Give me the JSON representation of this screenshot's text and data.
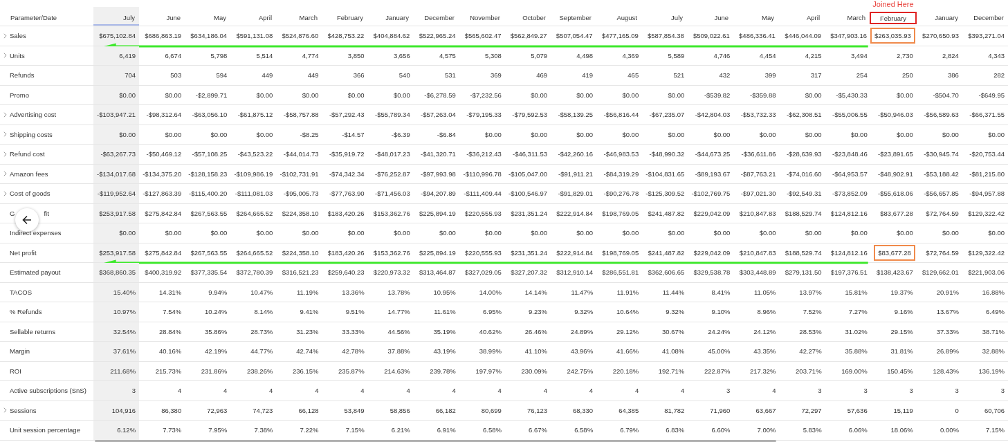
{
  "annotation": {
    "label": "Joined Here"
  },
  "table": {
    "corner": "Parameter/Date",
    "columns": [
      {
        "label": "July",
        "selected": true,
        "highlighted": false
      },
      {
        "label": "June",
        "selected": false,
        "highlighted": false
      },
      {
        "label": "May",
        "selected": false,
        "highlighted": false
      },
      {
        "label": "April",
        "selected": false,
        "highlighted": false
      },
      {
        "label": "March",
        "selected": false,
        "highlighted": false
      },
      {
        "label": "February",
        "selected": false,
        "highlighted": false
      },
      {
        "label": "January",
        "selected": false,
        "highlighted": false
      },
      {
        "label": "December",
        "selected": false,
        "highlighted": false
      },
      {
        "label": "November",
        "selected": false,
        "highlighted": false
      },
      {
        "label": "October",
        "selected": false,
        "highlighted": false
      },
      {
        "label": "September",
        "selected": false,
        "highlighted": false
      },
      {
        "label": "August",
        "selected": false,
        "highlighted": false
      },
      {
        "label": "July",
        "selected": false,
        "highlighted": false
      },
      {
        "label": "June",
        "selected": false,
        "highlighted": false
      },
      {
        "label": "May",
        "selected": false,
        "highlighted": false
      },
      {
        "label": "April",
        "selected": false,
        "highlighted": false
      },
      {
        "label": "March",
        "selected": false,
        "highlighted": false
      },
      {
        "label": "February",
        "selected": false,
        "highlighted": true
      },
      {
        "label": "January",
        "selected": false,
        "highlighted": false
      },
      {
        "label": "December",
        "selected": false,
        "highlighted": false
      }
    ],
    "rows": [
      {
        "label": "Sales",
        "expandable": true,
        "highlighted": true,
        "values": [
          "$675,102.84",
          "$686,863.19",
          "$634,186.04",
          "$591,131.08",
          "$524,876.60",
          "$428,753.22",
          "$404,884.62",
          "$522,965.24",
          "$565,602.47",
          "$562,849.27",
          "$507,054.47",
          "$477,165.09",
          "$587,854.38",
          "$509,022.61",
          "$486,336.41",
          "$446,044.09",
          "$347,903.16",
          "$263,035.93",
          "$270,650.93",
          "$393,271.04"
        ]
      },
      {
        "label": "Units",
        "expandable": true,
        "highlighted": false,
        "values": [
          "6,419",
          "6,674",
          "5,798",
          "5,514",
          "4,774",
          "3,850",
          "3,656",
          "4,575",
          "5,308",
          "5,079",
          "4,498",
          "4,369",
          "5,589",
          "4,746",
          "4,454",
          "4,215",
          "3,494",
          "2,730",
          "2,824",
          "4,343"
        ]
      },
      {
        "label": "Refunds",
        "expandable": false,
        "highlighted": false,
        "values": [
          "704",
          "503",
          "594",
          "449",
          "449",
          "366",
          "540",
          "531",
          "369",
          "469",
          "419",
          "465",
          "521",
          "432",
          "399",
          "317",
          "254",
          "250",
          "386",
          "282"
        ]
      },
      {
        "label": "Promo",
        "expandable": false,
        "highlighted": false,
        "values": [
          "$0.00",
          "$0.00",
          "-$2,899.71",
          "$0.00",
          "$0.00",
          "$0.00",
          "$0.00",
          "-$6,278.59",
          "-$7,232.56",
          "$0.00",
          "$0.00",
          "$0.00",
          "$0.00",
          "-$539.82",
          "-$359.88",
          "$0.00",
          "-$5,430.33",
          "$0.00",
          "-$504.70",
          "-$649.95"
        ]
      },
      {
        "label": "Advertising cost",
        "expandable": true,
        "highlighted": false,
        "values": [
          "-$103,947.21",
          "-$98,312.64",
          "-$63,056.10",
          "-$61,875.12",
          "-$58,757.88",
          "-$57,292.43",
          "-$55,789.34",
          "-$57,263.04",
          "-$79,195.33",
          "-$79,592.53",
          "-$58,139.25",
          "-$56,816.44",
          "-$67,235.07",
          "-$42,804.03",
          "-$53,732.33",
          "-$62,308.51",
          "-$55,006.55",
          "-$50,946.03",
          "-$56,589.63",
          "-$66,371.55"
        ]
      },
      {
        "label": "Shipping costs",
        "expandable": true,
        "highlighted": false,
        "values": [
          "$0.00",
          "$0.00",
          "$0.00",
          "$0.00",
          "-$8.25",
          "-$14.57",
          "-$6.39",
          "-$6.84",
          "$0.00",
          "$0.00",
          "$0.00",
          "$0.00",
          "$0.00",
          "$0.00",
          "$0.00",
          "$0.00",
          "$0.00",
          "$0.00",
          "$0.00",
          "$0.00"
        ]
      },
      {
        "label": "Refund cost",
        "expandable": true,
        "highlighted": false,
        "values": [
          "-$63,267.73",
          "-$50,469.12",
          "-$57,108.25",
          "-$43,523.22",
          "-$44,014.73",
          "-$35,919.72",
          "-$48,017.23",
          "-$41,320.71",
          "-$36,212.43",
          "-$46,311.53",
          "-$42,260.16",
          "-$46,983.53",
          "-$48,990.32",
          "-$44,673.25",
          "-$36,611.86",
          "-$28,639.93",
          "-$23,848.46",
          "-$23,891.65",
          "-$30,945.74",
          "-$20,753.44"
        ]
      },
      {
        "label": "Amazon fees",
        "expandable": true,
        "highlighted": false,
        "values": [
          "-$134,017.68",
          "-$134,375.20",
          "-$128,158.23",
          "-$109,986.19",
          "-$102,731.91",
          "-$74,342.34",
          "-$76,252.87",
          "-$97,993.98",
          "-$110,996.78",
          "-$105,047.00",
          "-$91,911.21",
          "-$84,319.29",
          "-$104,831.65",
          "-$89,193.67",
          "-$87,763.21",
          "-$74,016.60",
          "-$64,953.57",
          "-$48,902.91",
          "-$53,188.42",
          "-$81,215.80"
        ]
      },
      {
        "label": "Cost of goods",
        "expandable": true,
        "highlighted": false,
        "values": [
          "-$119,952.64",
          "-$127,863.39",
          "-$115,400.20",
          "-$111,081.03",
          "-$95,005.73",
          "-$77,763.90",
          "-$71,456.03",
          "-$94,207.89",
          "-$111,409.44",
          "-$100,546.97",
          "-$91,829.01",
          "-$90,276.78",
          "-$125,309.52",
          "-$102,769.75",
          "-$97,021.30",
          "-$92,549.31",
          "-$73,852.09",
          "-$55,618.06",
          "-$56,657.85",
          "-$94,957.88"
        ]
      },
      {
        "label": "G",
        "label_tail": "fit",
        "expandable": false,
        "highlighted": false,
        "values": [
          "$253,917.58",
          "$275,842.84",
          "$267,563.55",
          "$264,665.52",
          "$224,358.10",
          "$183,420.26",
          "$153,362.76",
          "$225,894.19",
          "$220,555.93",
          "$231,351.24",
          "$222,914.84",
          "$198,769.05",
          "$241,487.82",
          "$229,042.09",
          "$210,847.83",
          "$188,529.74",
          "$124,812.16",
          "$83,677.28",
          "$72,764.59",
          "$129,322.42"
        ]
      },
      {
        "label": "Indirect expenses",
        "expandable": false,
        "highlighted": false,
        "values": [
          "$0.00",
          "$0.00",
          "$0.00",
          "$0.00",
          "$0.00",
          "$0.00",
          "$0.00",
          "$0.00",
          "$0.00",
          "$0.00",
          "$0.00",
          "$0.00",
          "$0.00",
          "$0.00",
          "$0.00",
          "$0.00",
          "$0.00",
          "$0.00",
          "$0.00",
          "$0.00"
        ]
      },
      {
        "label": "Net profit",
        "expandable": false,
        "highlighted": true,
        "values": [
          "$253,917.58",
          "$275,842.84",
          "$267,563.55",
          "$264,665.52",
          "$224,358.10",
          "$183,420.26",
          "$153,362.76",
          "$225,894.19",
          "$220,555.93",
          "$231,351.24",
          "$222,914.84",
          "$198,769.05",
          "$241,487.82",
          "$229,042.09",
          "$210,847.83",
          "$188,529.74",
          "$124,812.16",
          "$83,677.28",
          "$72,764.59",
          "$129,322.42"
        ]
      },
      {
        "label": "Estimated payout",
        "expandable": false,
        "highlighted": false,
        "values": [
          "$368,860.35",
          "$400,319.92",
          "$377,335.54",
          "$372,780.39",
          "$316,521.23",
          "$259,640.23",
          "$220,973.32",
          "$313,464.87",
          "$327,029.05",
          "$327,207.32",
          "$312,910.14",
          "$286,551.81",
          "$362,606.65",
          "$329,538.78",
          "$303,448.89",
          "$279,131.50",
          "$197,376.51",
          "$138,423.67",
          "$129,662.01",
          "$221,903.06"
        ]
      },
      {
        "label": "TACOS",
        "expandable": false,
        "highlighted": false,
        "values": [
          "15.40%",
          "14.31%",
          "9.94%",
          "10.47%",
          "11.19%",
          "13.36%",
          "13.78%",
          "10.95%",
          "14.00%",
          "14.14%",
          "11.47%",
          "11.91%",
          "11.44%",
          "8.41%",
          "11.05%",
          "13.97%",
          "15.81%",
          "19.37%",
          "20.91%",
          "16.88%"
        ]
      },
      {
        "label": "% Refunds",
        "expandable": false,
        "highlighted": false,
        "values": [
          "10.97%",
          "7.54%",
          "10.24%",
          "8.14%",
          "9.41%",
          "9.51%",
          "14.77%",
          "11.61%",
          "6.95%",
          "9.23%",
          "9.32%",
          "10.64%",
          "9.32%",
          "9.10%",
          "8.96%",
          "7.52%",
          "7.27%",
          "9.16%",
          "13.67%",
          "6.49%"
        ]
      },
      {
        "label": "Sellable returns",
        "expandable": false,
        "highlighted": false,
        "values": [
          "32.54%",
          "28.84%",
          "35.86%",
          "28.73%",
          "31.23%",
          "33.33%",
          "44.56%",
          "35.19%",
          "40.62%",
          "26.46%",
          "24.89%",
          "29.12%",
          "30.67%",
          "24.24%",
          "24.12%",
          "28.53%",
          "31.02%",
          "29.15%",
          "37.33%",
          "38.71%"
        ]
      },
      {
        "label": "Margin",
        "expandable": false,
        "highlighted": false,
        "values": [
          "37.61%",
          "40.16%",
          "42.19%",
          "44.77%",
          "42.74%",
          "42.78%",
          "37.88%",
          "43.19%",
          "38.99%",
          "41.10%",
          "43.96%",
          "41.66%",
          "41.08%",
          "45.00%",
          "43.35%",
          "42.27%",
          "35.88%",
          "31.81%",
          "26.89%",
          "32.88%"
        ]
      },
      {
        "label": "ROI",
        "expandable": false,
        "highlighted": false,
        "values": [
          "211.68%",
          "215.73%",
          "231.86%",
          "238.26%",
          "236.15%",
          "235.87%",
          "214.63%",
          "239.78%",
          "197.97%",
          "230.09%",
          "242.75%",
          "220.18%",
          "192.71%",
          "222.87%",
          "217.32%",
          "203.71%",
          "169.00%",
          "150.45%",
          "128.43%",
          "136.19%"
        ]
      },
      {
        "label": "Active subscriptions (SnS)",
        "expandable": false,
        "highlighted": false,
        "values": [
          "3",
          "4",
          "4",
          "4",
          "4",
          "4",
          "4",
          "4",
          "4",
          "4",
          "4",
          "4",
          "4",
          "3",
          "4",
          "3",
          "3",
          "3",
          "3",
          "3"
        ]
      },
      {
        "label": "Sessions",
        "expandable": true,
        "highlighted": false,
        "values": [
          "104,916",
          "86,380",
          "72,963",
          "74,723",
          "66,128",
          "53,849",
          "58,856",
          "66,182",
          "80,699",
          "76,123",
          "68,330",
          "64,385",
          "81,782",
          "71,960",
          "63,667",
          "72,297",
          "57,636",
          "15,119",
          "0",
          "60,706"
        ]
      },
      {
        "label": "Unit session percentage",
        "expandable": false,
        "highlighted": false,
        "values": [
          "6.12%",
          "7.73%",
          "7.95%",
          "7.38%",
          "7.22%",
          "7.15%",
          "6.21%",
          "6.91%",
          "6.58%",
          "6.67%",
          "6.58%",
          "6.79%",
          "6.83%",
          "6.60%",
          "7.00%",
          "5.83%",
          "6.06%",
          "18.06%",
          "0.00%",
          "7.15%"
        ]
      }
    ]
  }
}
